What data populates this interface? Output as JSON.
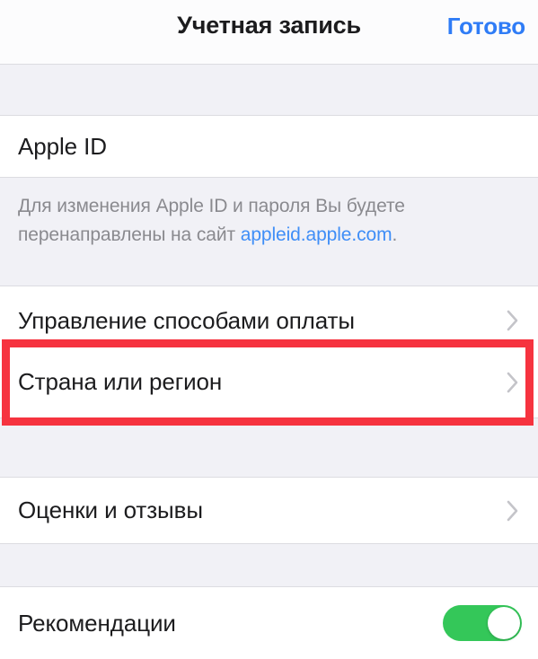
{
  "navbar": {
    "title": "Учетная запись",
    "done_label": "Готово"
  },
  "sections": {
    "apple_id": {
      "row_label": "Apple ID",
      "note_prefix": "Для изменения Apple ID и пароля Вы будете перенаправлены на сайт ",
      "note_link": "appleid.apple.com",
      "note_suffix": "."
    },
    "account_options": {
      "payment_label": "Управление способами оплаты",
      "country_label": "Страна или регион"
    },
    "reviews": {
      "label": "Оценки и отзывы"
    },
    "recommendations": {
      "label": "Рекомендации",
      "toggle_state": "on"
    }
  },
  "annotation": {
    "highlight_target": "Страна или регион",
    "highlight_color": "#f6333f"
  },
  "theme": {
    "accent_blue": "#2f7cf6",
    "link_blue": "#3f8ef7",
    "toggle_green": "#34c759",
    "background_gray": "#f1f1f6",
    "row_white": "#ffffff",
    "text_primary": "#1c1c1e",
    "text_secondary": "#8a8a8f",
    "chevron_gray": "#c4c4c9"
  }
}
